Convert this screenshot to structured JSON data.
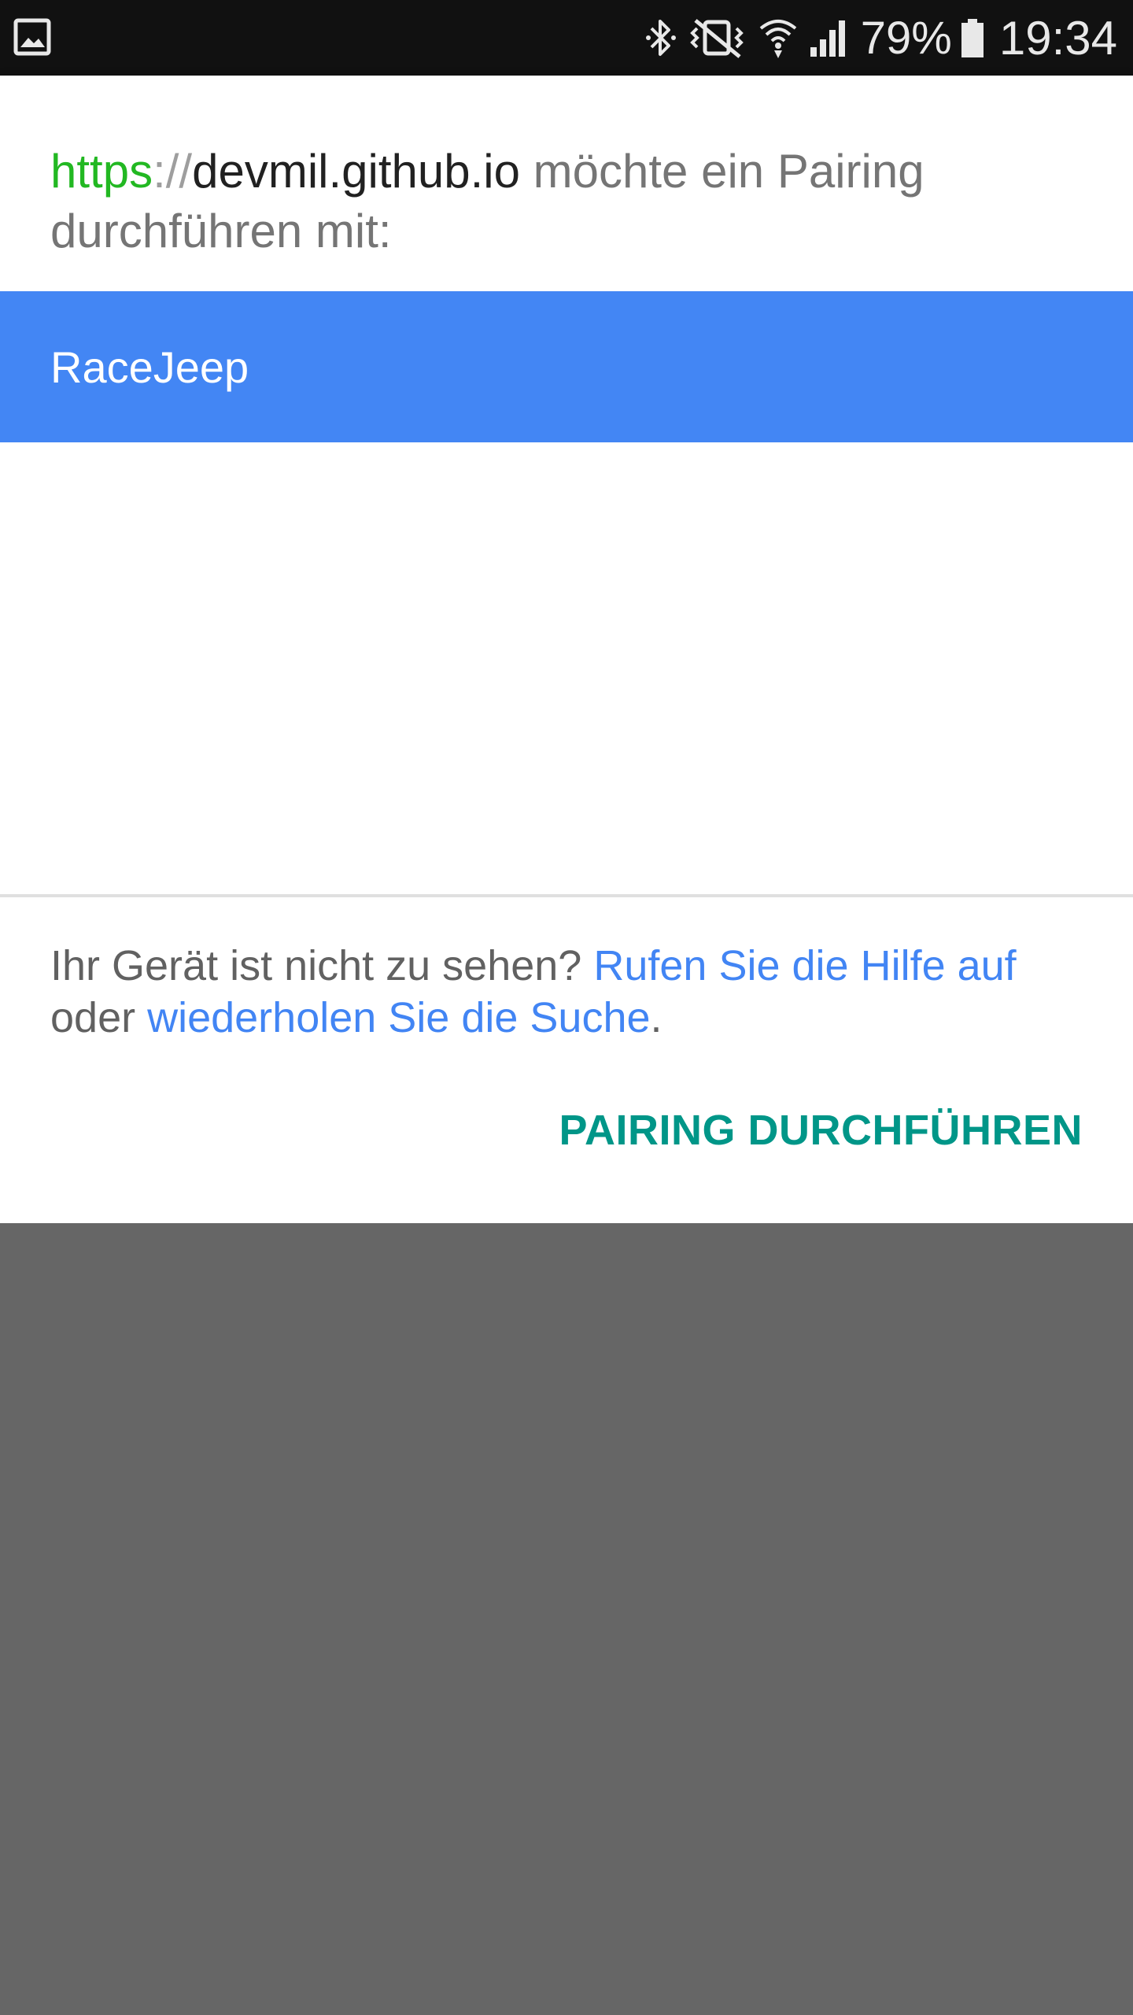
{
  "status_bar": {
    "icons": [
      "gallery-icon",
      "bluetooth-icon",
      "vibrate-mute-icon",
      "wifi-icon",
      "signal-icon",
      "battery-icon"
    ],
    "battery_percent": "79%",
    "time": "19:34"
  },
  "dialog": {
    "title": {
      "scheme": "https",
      "separator": "://",
      "host": "devmil.github.io",
      "message": " möchte ein Pairing durchführen mit:"
    },
    "devices": [
      {
        "name": "RaceJeep",
        "selected": true
      }
    ],
    "help": {
      "prefix": "Ihr Gerät ist nicht zu sehen? ",
      "help_link": "Rufen Sie die Hilfe auf",
      "middle": " oder ",
      "retry_link": "wiederholen Sie die Suche",
      "suffix": "."
    },
    "pair_button_label": "PAIRING DURCHFÜHREN"
  },
  "colors": {
    "status_bar_bg": "#111111",
    "selected_device_bg": "#4386f4",
    "link": "#4285f4",
    "scheme": "#22b822",
    "button_text": "#009688",
    "overlay": "#666666"
  }
}
